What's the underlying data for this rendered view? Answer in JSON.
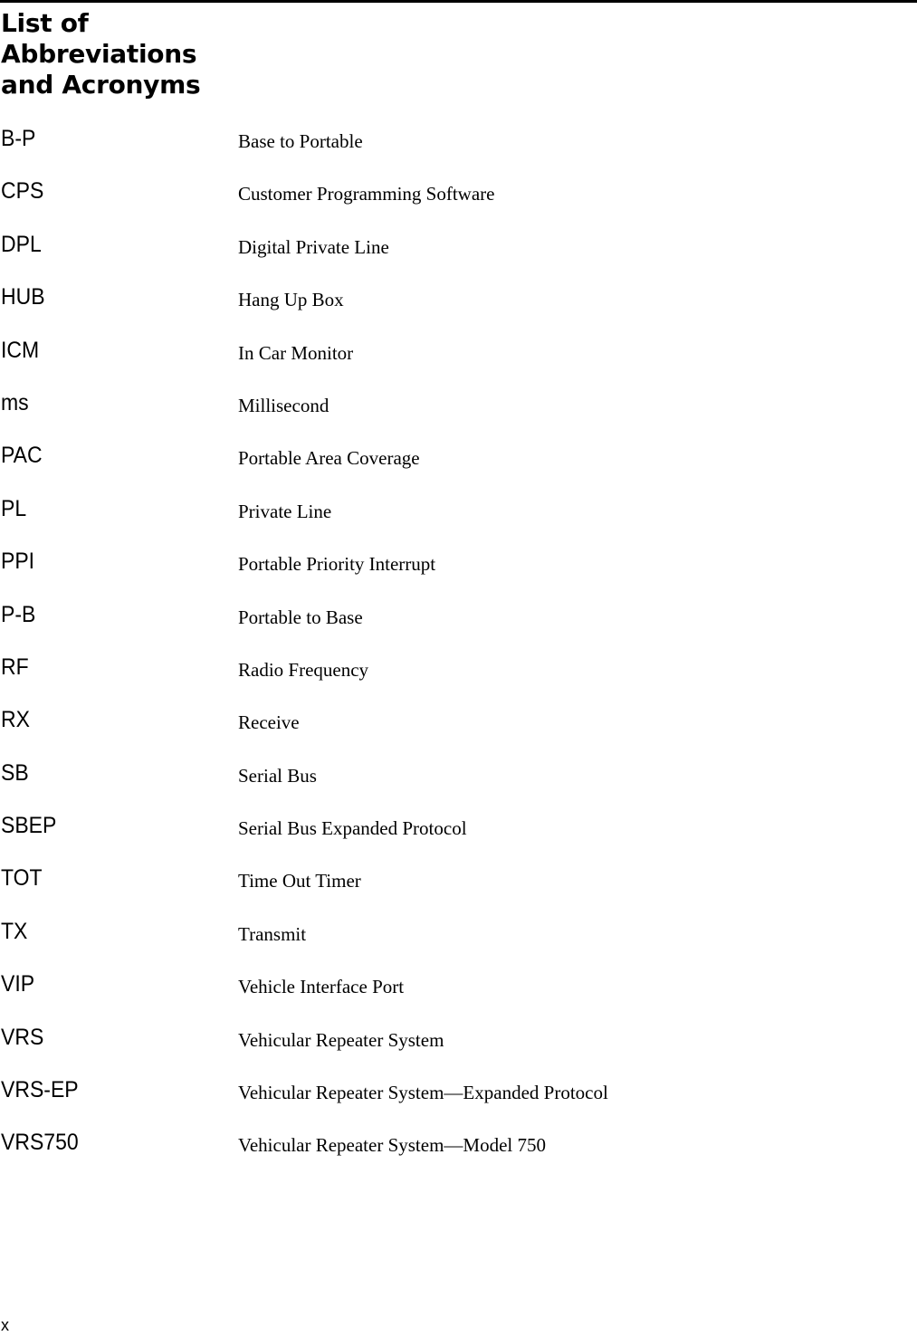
{
  "page": {
    "title_lines": [
      "List of",
      "Abbreviations",
      "and Acronyms"
    ],
    "entries": [
      {
        "abbr": "B-P",
        "definition": "Base to Portable"
      },
      {
        "abbr": "CPS",
        "definition": "Customer Programming Software"
      },
      {
        "abbr": "DPL",
        "definition": "Digital Private Line"
      },
      {
        "abbr": "HUB",
        "definition": "Hang Up Box"
      },
      {
        "abbr": "ICM",
        "definition": "In Car Monitor"
      },
      {
        "abbr": "ms",
        "definition": "Millisecond"
      },
      {
        "abbr": "PAC",
        "definition": "Portable Area Coverage"
      },
      {
        "abbr": "PL",
        "definition": "Private Line"
      },
      {
        "abbr": "PPI",
        "definition": "Portable Priority Interrupt"
      },
      {
        "abbr": "P-B",
        "definition": "Portable to Base"
      },
      {
        "abbr": "RF",
        "definition": "Radio Frequency"
      },
      {
        "abbr": "RX",
        "definition": "Receive"
      },
      {
        "abbr": "SB",
        "definition": "Serial Bus"
      },
      {
        "abbr": "SBEP",
        "definition": "Serial Bus Expanded Protocol"
      },
      {
        "abbr": "TOT",
        "definition": "Time Out Timer"
      },
      {
        "abbr": "TX",
        "definition": "Transmit"
      },
      {
        "abbr": "VIP",
        "definition": "Vehicle Interface Port"
      },
      {
        "abbr": "VRS",
        "definition": "Vehicular Repeater System"
      },
      {
        "abbr": "VRS-EP",
        "definition": "Vehicular Repeater System—Expanded Protocol"
      },
      {
        "abbr": "VRS750",
        "definition": "Vehicular Repeater System—Model 750"
      }
    ],
    "page_number": "x"
  }
}
